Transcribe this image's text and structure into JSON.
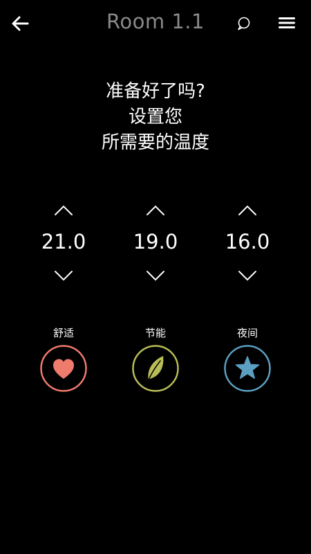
{
  "header": {
    "title": "Room 1.1",
    "back_icon": "arrow-left-icon",
    "chat_icon": "chat-bubble-icon",
    "menu_icon": "hamburger-menu-icon"
  },
  "heading": {
    "accent_line": "准备好了吗?",
    "line2": "设置您",
    "line3": "所需要的温度"
  },
  "temperatures": [
    {
      "value": "21.0"
    },
    {
      "value": "19.0"
    },
    {
      "value": "16.0"
    }
  ],
  "modes": [
    {
      "label": "舒适",
      "icon": "heart-icon",
      "color": "#ef7b6c"
    },
    {
      "label": "节能",
      "icon": "leaf-icon",
      "color": "#b9bd57"
    },
    {
      "label": "夜间",
      "icon": "star-icon",
      "color": "#5b9fc2"
    }
  ],
  "colors": {
    "background": "#000000",
    "title": "#8a8a8a",
    "accent": "#b9bd57",
    "text": "#ffffff"
  }
}
